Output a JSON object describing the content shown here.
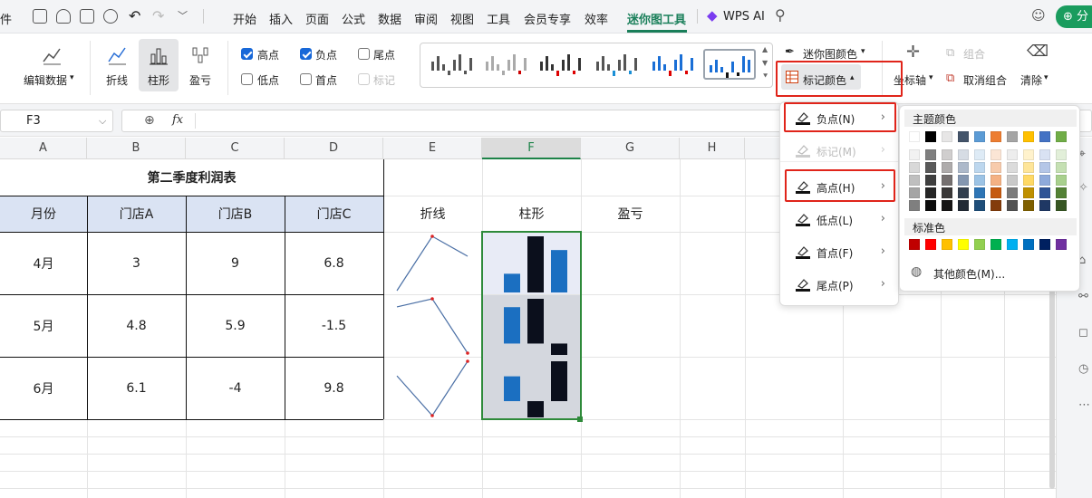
{
  "menubar": {
    "file_fragment": "件",
    "tabs": [
      "开始",
      "插入",
      "页面",
      "公式",
      "数据",
      "审阅",
      "视图",
      "工具",
      "会员专享",
      "效率",
      "迷你图工具"
    ],
    "active_tab": "迷你图工具",
    "wps_ai": "WPS AI",
    "share": "分"
  },
  "ribbon": {
    "edit_data": "编辑数据",
    "type_line": "折线",
    "type_column": "柱形",
    "type_winloss": "盈亏",
    "checks": {
      "high": {
        "label": "高点",
        "checked": true
      },
      "negative": {
        "label": "负点",
        "checked": true
      },
      "last": {
        "label": "尾点",
        "checked": false
      },
      "low": {
        "label": "低点",
        "checked": false
      },
      "first": {
        "label": "首点",
        "checked": false
      },
      "markers": {
        "label": "标记",
        "checked": false,
        "disabled": true
      }
    },
    "sparkline_color": "迷你图颜色",
    "marker_color": "标记颜色",
    "axis": "坐标轴",
    "group": "组合",
    "ungroup": "取消组合",
    "clear": "清除"
  },
  "formula_bar": {
    "name_box": "F3",
    "fx": "fx",
    "value": ""
  },
  "columns": [
    "A",
    "B",
    "C",
    "D",
    "E",
    "F",
    "G",
    "H"
  ],
  "selected_column": "F",
  "sheet": {
    "title": "第二季度利润表",
    "headers": [
      "月份",
      "门店A",
      "门店B",
      "门店C"
    ],
    "rows": [
      [
        "4月",
        "3",
        "9",
        "6.8"
      ],
      [
        "5月",
        "4.8",
        "5.9",
        "-1.5"
      ],
      [
        "6月",
        "6.1",
        "-4",
        "9.8"
      ]
    ],
    "labels": {
      "line": "折线",
      "column": "柱形",
      "winloss": "盈亏"
    },
    "values": [
      [
        3,
        9,
        6.8
      ],
      [
        4.8,
        5.9,
        -1.5
      ],
      [
        6.1,
        -4,
        9.8
      ]
    ]
  },
  "marker_menu": {
    "items": [
      {
        "label": "负点(N)",
        "disabled": false
      },
      {
        "label": "标记(M)",
        "disabled": true
      },
      {
        "label": "高点(H)",
        "disabled": false
      },
      {
        "label": "低点(L)",
        "disabled": false
      },
      {
        "label": "首点(F)",
        "disabled": false
      },
      {
        "label": "尾点(P)",
        "disabled": false
      }
    ]
  },
  "color_palette": {
    "theme_title": "主题颜色",
    "theme_row": [
      "#ffffff",
      "#000000",
      "#e7e6e6",
      "#44546a",
      "#5b9bd5",
      "#ed7d31",
      "#a5a5a5",
      "#ffc000",
      "#4472c4",
      "#70ad47"
    ],
    "theme_shades": [
      [
        "#f2f2f2",
        "#7f7f7f",
        "#d0cece",
        "#d6dce4",
        "#deebf6",
        "#fbe5d5",
        "#ededed",
        "#fff2cc",
        "#d9e2f3",
        "#e2efd9"
      ],
      [
        "#d8d8d8",
        "#595959",
        "#aeabab",
        "#adb9ca",
        "#bdd7ee",
        "#f7cbac",
        "#dbdbdb",
        "#fee599",
        "#b4c6e7",
        "#c5e0b3"
      ],
      [
        "#bfbfbf",
        "#3f3f3f",
        "#757070",
        "#8496b0",
        "#9cc3e5",
        "#f4b183",
        "#c9c9c9",
        "#ffd965",
        "#8eaadb",
        "#a8d08d"
      ],
      [
        "#a5a5a5",
        "#262626",
        "#3a3838",
        "#323f4f",
        "#2e75b5",
        "#c55a11",
        "#7b7b7b",
        "#bf9000",
        "#2f5496",
        "#538135"
      ],
      [
        "#7f7f7f",
        "#0c0c0c",
        "#171616",
        "#222a35",
        "#1e4e79",
        "#833c0b",
        "#525252",
        "#7f6000",
        "#1f3864",
        "#375623"
      ]
    ],
    "standard_title": "标准色",
    "standard": [
      "#c00000",
      "#ff0000",
      "#ffc000",
      "#ffff00",
      "#92d050",
      "#00b050",
      "#00b0f0",
      "#0070c0",
      "#002060",
      "#7030a0"
    ],
    "more": "其他颜色(M)..."
  }
}
